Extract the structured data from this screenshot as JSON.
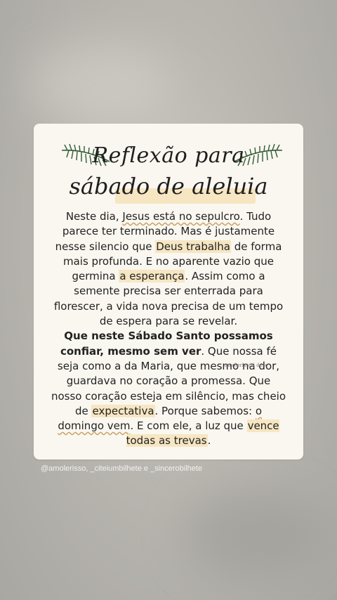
{
  "title": {
    "line1": "Reflexão para",
    "line2": "sábado de aleluia"
  },
  "body": {
    "p1": {
      "a": "Neste dia, ",
      "b": "Jesus está no sepulcro",
      "c": ". Tudo parece ter terminado. Mas é justamente nesse silencio que ",
      "d": "Deus trabalha",
      "e": " de forma mais profunda. E no aparente vazio que germina ",
      "f": "a esperança",
      "g": ". Assim como a semente precisa ser enterrada para florescer, a vida nova precisa de um tempo de espera para se revelar."
    },
    "p2": {
      "bold": "Que neste Sábado Santo possamos confiar, mesmo sem ver",
      "a": ". Que nossa fé seja como a da Maria, que mesmo na dor, guardava no coração a promessa. Que nosso coração esteja em silêncio, mas cheio de ",
      "b": "expectativa",
      "c": ". Porque sabemos: ",
      "d": "o domingo vem",
      "e": ". E com ele, a luz que ",
      "f": "vence todas as trevas",
      "g": "."
    }
  },
  "watermark": "amolerisso | desc",
  "credits": "@amolerisso, _citeiumbilhete e _sincerobilhete",
  "colors": {
    "highlight": "#f6e6c2",
    "leaf": "#2f5a35",
    "card": "#faf7f0"
  }
}
